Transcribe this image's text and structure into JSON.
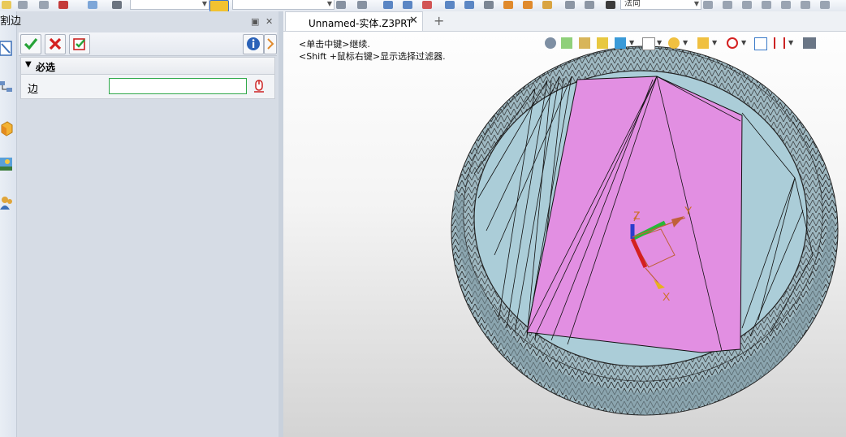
{
  "panel": {
    "title": "割边",
    "confirm_icon": "check-icon",
    "cancel_icon": "x-icon",
    "apply_icon": "apply-check-icon",
    "info_icon": "info-icon",
    "section_label": "必选",
    "edge_label": "边",
    "edge_value": "",
    "pick_icon": "mouse-pick-icon"
  },
  "toolbar": {
    "direction_combo": "法向",
    "combo_empty": ""
  },
  "document": {
    "tab_name": "Unnamed-实体.Z3PRT",
    "tab_close": "✕",
    "tab_add": "+",
    "hint_line1": "<单击中键>继续.",
    "hint_line2": "<Shift +鼠标右键>显示选择过滤器."
  },
  "axes": {
    "x": "X",
    "y": "Y",
    "z": "Z"
  },
  "colors": {
    "accent_green": "#2fa84a",
    "model_teal": "#a9c9d8",
    "model_face": "#e28fe2",
    "model_rim": "#8fa9b2"
  }
}
